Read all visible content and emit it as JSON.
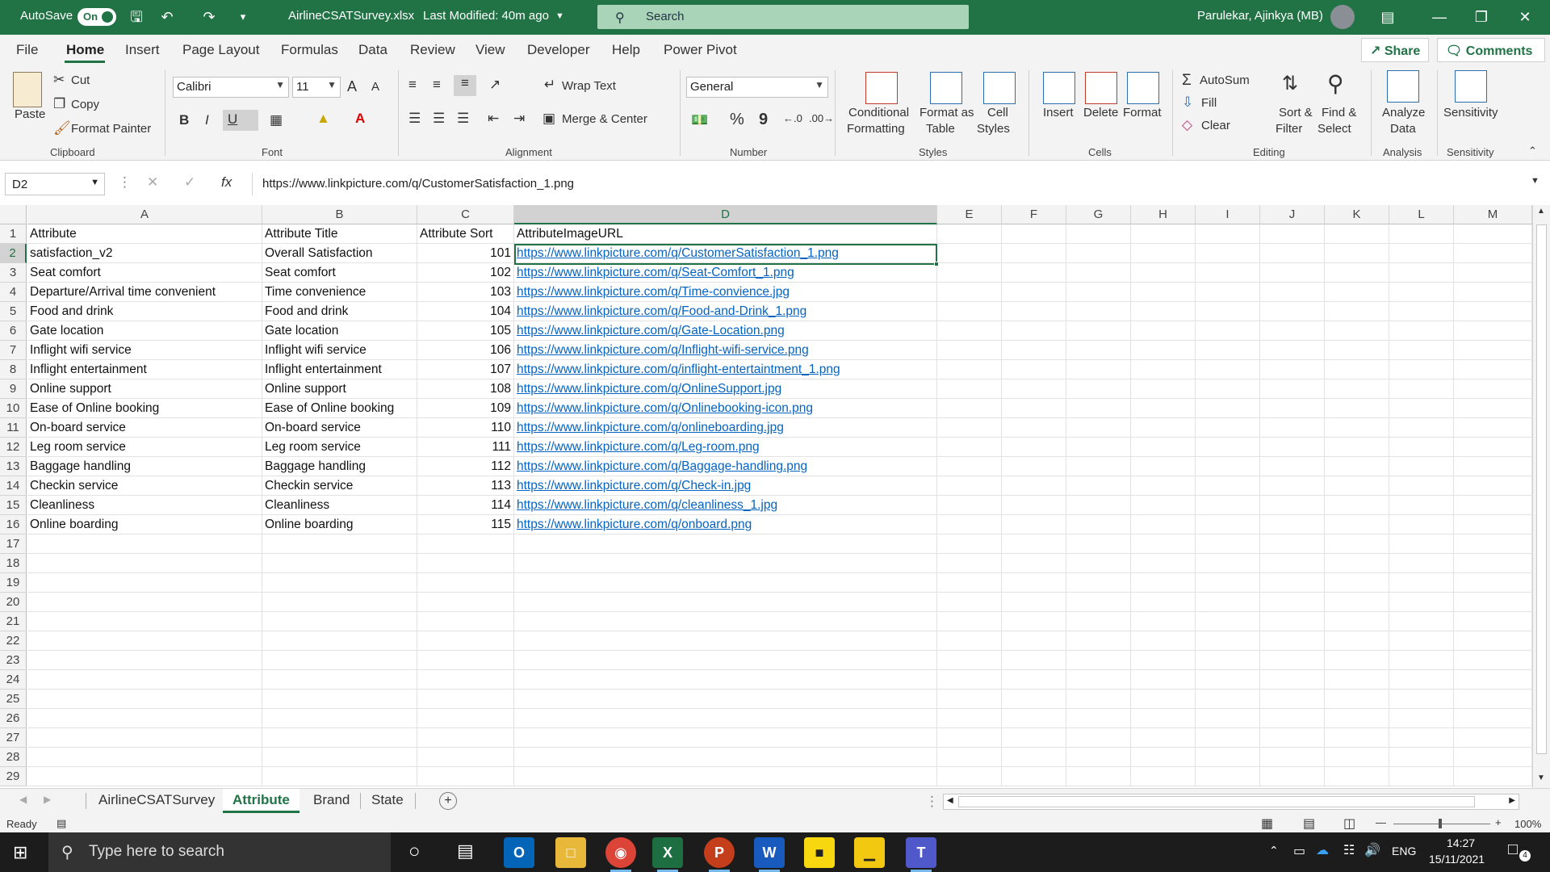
{
  "titlebar": {
    "autosave_label": "AutoSave",
    "autosave_state": "On",
    "filename": "AirlineCSATSurvey.xlsx",
    "last_modified": "Last Modified: 40m ago",
    "search_placeholder": "Search",
    "user_name": "Parulekar, Ajinkya (MB)"
  },
  "menu": {
    "tabs": [
      "File",
      "Home",
      "Insert",
      "Page Layout",
      "Formulas",
      "Data",
      "Review",
      "View",
      "Developer",
      "Help",
      "Power Pivot"
    ],
    "share_label": "Share",
    "comments_label": "Comments"
  },
  "ribbon": {
    "clipboard": {
      "paste": "Paste",
      "cut": "Cut",
      "copy": "Copy",
      "format_painter": "Format Painter",
      "group": "Clipboard"
    },
    "font": {
      "name": "Calibri",
      "size": "11",
      "bold": "B",
      "italic": "I",
      "underline": "U",
      "grow": "A",
      "shrink": "A",
      "group": "Font"
    },
    "alignment": {
      "wrap_text": "Wrap Text",
      "merge_center": "Merge & Center",
      "group": "Alignment"
    },
    "number": {
      "format": "General",
      "percent": "%",
      "comma": "9",
      "group": "Number"
    },
    "styles": {
      "conditional_line1": "Conditional",
      "conditional_line2": "Formatting",
      "format_table_line1": "Format as",
      "format_table_line2": "Table",
      "cell_styles_line1": "Cell",
      "cell_styles_line2": "Styles",
      "group": "Styles"
    },
    "cells": {
      "insert": "Insert",
      "delete": "Delete",
      "format": "Format",
      "group": "Cells"
    },
    "editing": {
      "autosum": "AutoSum",
      "fill": "Fill",
      "clear": "Clear",
      "sort_line1": "Sort &",
      "sort_line2": "Filter",
      "find_line1": "Find &",
      "find_line2": "Select",
      "group": "Editing"
    },
    "analysis": {
      "analyze_line1": "Analyze",
      "analyze_line2": "Data",
      "group": "Analysis"
    },
    "sensitivity": {
      "label": "Sensitivity",
      "group": "Sensitivity"
    }
  },
  "formula_bar": {
    "name_box": "D2",
    "formula": "https://www.linkpicture.com/q/CustomerSatisfaction_1.png"
  },
  "grid": {
    "columns": [
      "A",
      "B",
      "C",
      "D",
      "E",
      "F",
      "G",
      "H",
      "I",
      "J",
      "K",
      "L",
      "M"
    ],
    "row_numbers": [
      "1",
      "2",
      "3",
      "4",
      "5",
      "6",
      "7",
      "8",
      "9",
      "10",
      "11",
      "12",
      "13",
      "14",
      "15",
      "16",
      "17",
      "18",
      "19",
      "20",
      "21",
      "22",
      "23",
      "24",
      "25",
      "26",
      "27",
      "28",
      "29"
    ],
    "header": {
      "a": "Attribute",
      "b": "Attribute Title",
      "c": "Attribute Sort",
      "d": "AttributeImageURL"
    },
    "rows": [
      {
        "a": "satisfaction_v2",
        "b": "Overall Satisfaction",
        "c": "101",
        "d": "https://www.linkpicture.com/q/CustomerSatisfaction_1.png"
      },
      {
        "a": "Seat comfort",
        "b": "Seat comfort",
        "c": "102",
        "d": "https://www.linkpicture.com/q/Seat-Comfort_1.png"
      },
      {
        "a": "Departure/Arrival time convenient",
        "b": "Time convenience",
        "c": "103",
        "d": "https://www.linkpicture.com/q/Time-convience.jpg"
      },
      {
        "a": "Food and drink",
        "b": "Food and drink",
        "c": "104",
        "d": "https://www.linkpicture.com/q/Food-and-Drink_1.png"
      },
      {
        "a": "Gate location",
        "b": "Gate location",
        "c": "105",
        "d": "https://www.linkpicture.com/q/Gate-Location.png"
      },
      {
        "a": "Inflight wifi service",
        "b": "Inflight wifi service",
        "c": "106",
        "d": "https://www.linkpicture.com/q/Inflight-wifi-service.png"
      },
      {
        "a": "Inflight entertainment",
        "b": "Inflight entertainment",
        "c": "107",
        "d": "https://www.linkpicture.com/q/inflight-entertaintment_1.png"
      },
      {
        "a": "Online support",
        "b": "Online support",
        "c": "108",
        "d": "https://www.linkpicture.com/q/OnlineSupport.jpg"
      },
      {
        "a": "Ease of Online booking",
        "b": "Ease of Online booking",
        "c": "109",
        "d": "https://www.linkpicture.com/q/Onlinebooking-icon.png"
      },
      {
        "a": "On-board service",
        "b": "On-board service",
        "c": "110",
        "d": "https://www.linkpicture.com/q/onlineboarding.jpg"
      },
      {
        "a": "Leg room service",
        "b": "Leg room service",
        "c": "111",
        "d": "https://www.linkpicture.com/q/Leg-room.png"
      },
      {
        "a": "Baggage handling",
        "b": "Baggage handling",
        "c": "112",
        "d": "https://www.linkpicture.com/q/Baggage-handling.png"
      },
      {
        "a": "Checkin service",
        "b": "Checkin service",
        "c": "113",
        "d": "https://www.linkpicture.com/q/Check-in.jpg"
      },
      {
        "a": "Cleanliness",
        "b": "Cleanliness",
        "c": "114",
        "d": "https://www.linkpicture.com/q/cleanliness_1.jpg"
      },
      {
        "a": "Online boarding",
        "b": "Online boarding",
        "c": "115",
        "d": "https://www.linkpicture.com/q/onboard.png"
      }
    ]
  },
  "sheets": {
    "tabs": [
      "AirlineCSATSurvey",
      "Attribute",
      "Brand",
      "State"
    ],
    "active": "Attribute"
  },
  "status": {
    "ready": "Ready",
    "zoom": "100%"
  },
  "taskbar": {
    "search_placeholder": "Type here to search",
    "language": "ENG",
    "time": "14:27",
    "date": "15/11/2021",
    "notifications": "4"
  },
  "colors": {
    "excel_green": "#217346",
    "link": "#0563c1"
  }
}
